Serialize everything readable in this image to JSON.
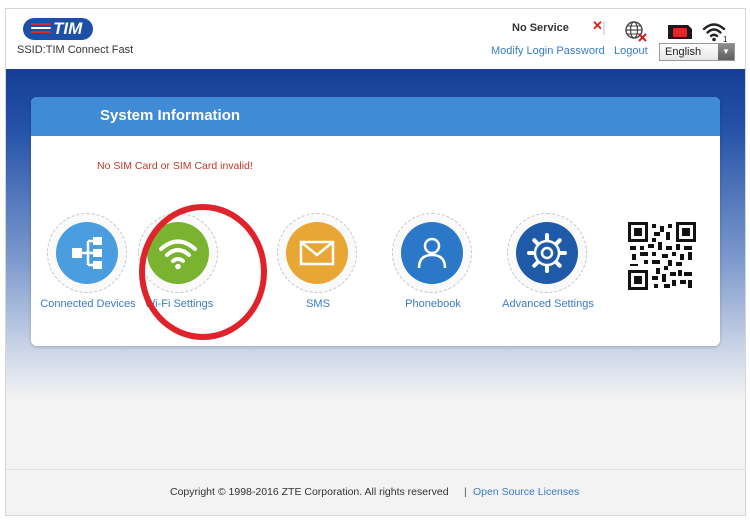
{
  "header": {
    "logo_text": "TIM",
    "ssid": "SSID:TIM Connect Fast",
    "network_status": "No Service",
    "wifi_clients": "1",
    "modify_password": "Modify Login Password",
    "logout": "Logout",
    "language": "English"
  },
  "panel": {
    "title": "System Information",
    "alert": "No SIM Card or SIM Card invalid!"
  },
  "tiles": [
    {
      "label": "Connected Devices",
      "icon": "connected-devices-icon",
      "color": "#4a9ee0"
    },
    {
      "label": "Wi-Fi Settings",
      "icon": "wifi-icon",
      "color": "#7ab32f"
    },
    {
      "label": "SMS",
      "icon": "envelope-icon",
      "color": "#e8a735"
    },
    {
      "label": "Phonebook",
      "icon": "person-icon",
      "color": "#2c78c8"
    },
    {
      "label": "Advanced Settings",
      "icon": "gear-icon",
      "color": "#1f5aa8"
    }
  ],
  "footer": {
    "copyright": "Copyright © 1998-2016 ZTE Corporation. All rights reserved",
    "separator": "|",
    "open_source": "Open Source Licenses"
  },
  "colors": {
    "header_blue": "#1d4fa6",
    "panel_header": "#3f8bd6",
    "link": "#3a7bc8",
    "alert": "#c0392b",
    "annotation": "#e0222a"
  }
}
